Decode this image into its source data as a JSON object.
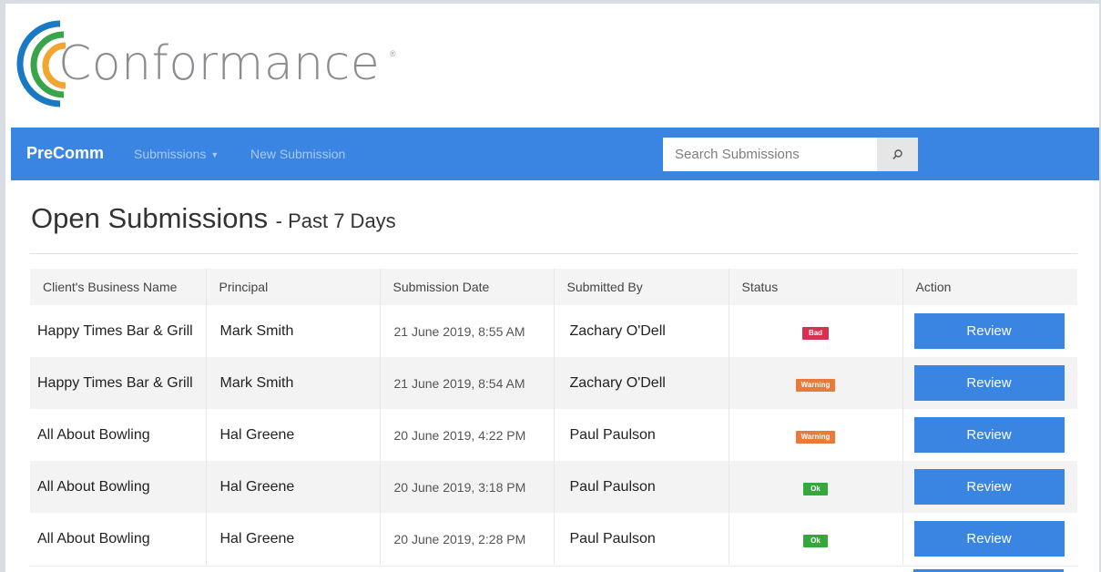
{
  "logo": {
    "text": "Conformance",
    "reg_mark": "®"
  },
  "navbar": {
    "brand": "PreComm",
    "submissions_label": "Submissions",
    "new_submission_label": "New Submission",
    "search_placeholder": "Search Submissions",
    "search_icon": "magnifier-icon",
    "color": "#3b85e2"
  },
  "page": {
    "title": "Open Submissions",
    "subtitle": "- Past 7 Days"
  },
  "table": {
    "headers": [
      "Client's Business Name",
      "Principal",
      "Submission Date",
      "Submitted By",
      "Status",
      "Action"
    ],
    "rows": [
      {
        "business": "Happy Times Bar & Grill",
        "principal": "Mark Smith",
        "date": "21 June 2019, 8:55 AM",
        "submitted_by": "Zachary O'Dell",
        "status": "Bad",
        "action": "Review"
      },
      {
        "business": "Happy Times Bar & Grill",
        "principal": "Mark Smith",
        "date": "21 June 2019, 8:54 AM",
        "submitted_by": "Zachary O'Dell",
        "status": "Warning",
        "action": "Review"
      },
      {
        "business": "All About Bowling",
        "principal": "Hal Greene",
        "date": "20 June 2019, 4:22 PM",
        "submitted_by": "Paul Paulson",
        "status": "Warning",
        "action": "Review"
      },
      {
        "business": "All About Bowling",
        "principal": "Hal Greene",
        "date": "20 June 2019, 3:18 PM",
        "submitted_by": "Paul Paulson",
        "status": "Ok",
        "action": "Review"
      },
      {
        "business": "All About Bowling",
        "principal": "Hal Greene",
        "date": "20 June 2019, 2:28 PM",
        "submitted_by": "Paul Paulson",
        "status": "Ok",
        "action": "Review"
      }
    ]
  },
  "status_colors": {
    "Bad": "#d9304f",
    "Warning": "#ea7a3a",
    "Ok": "#35a83c"
  }
}
